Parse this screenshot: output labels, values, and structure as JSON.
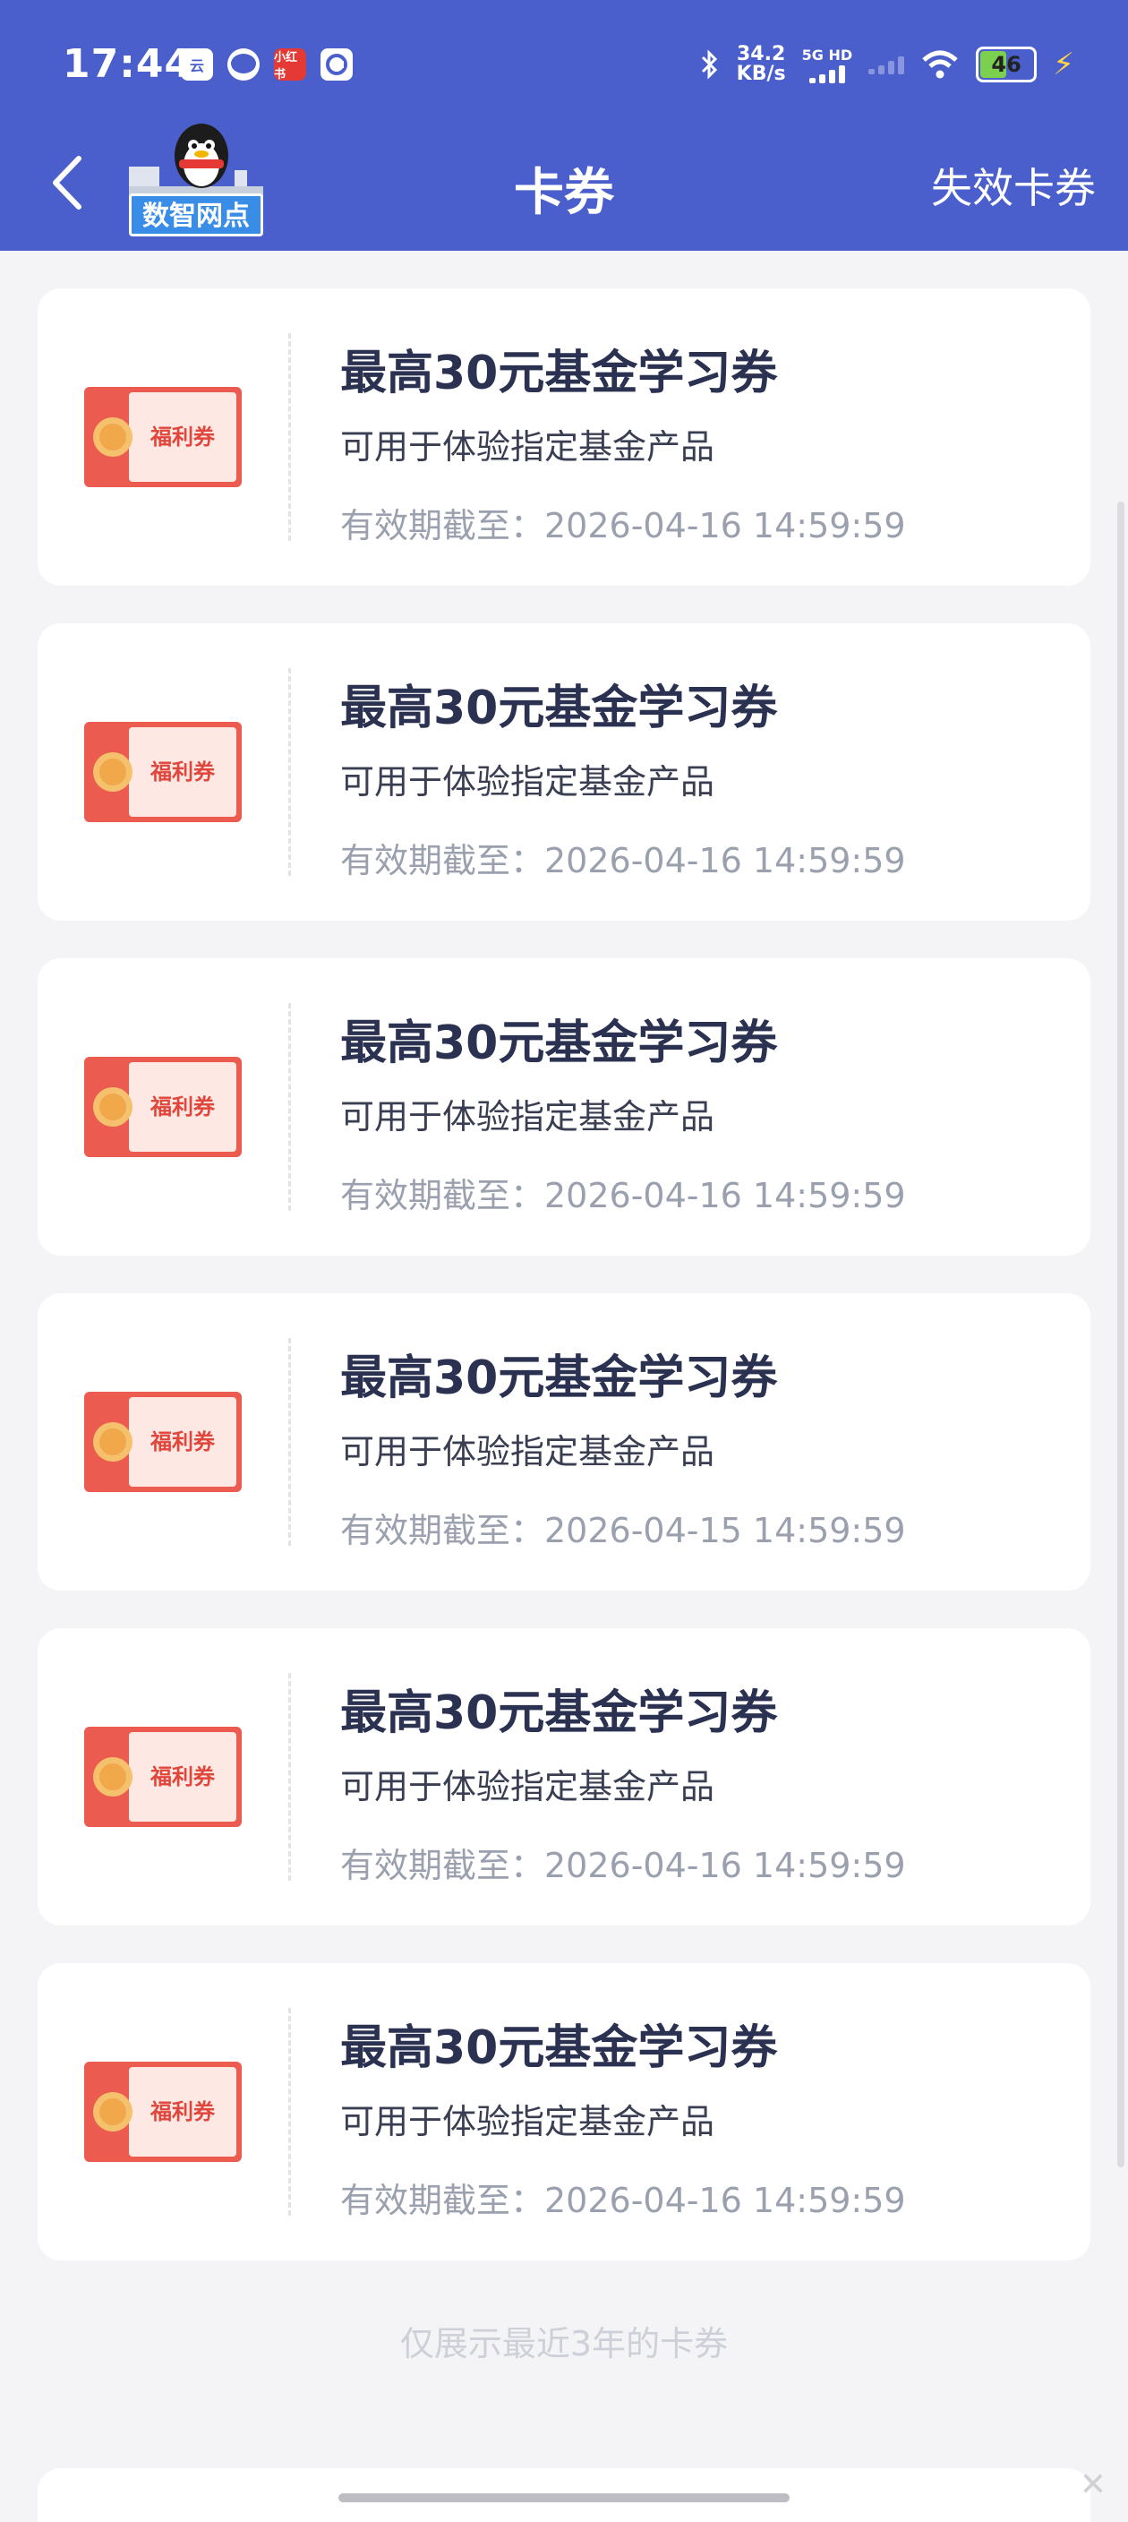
{
  "status_bar": {
    "time": "17:44",
    "net_speed_value": "34.2",
    "net_speed_unit": "KB/s",
    "network_label": "5G HD",
    "battery": "46",
    "app_icon_1": "云",
    "app_icon_3": "小红书"
  },
  "header": {
    "title": "卡券",
    "logo_text": "数智网点",
    "right_link": "失效卡券"
  },
  "coupons": [
    {
      "title": "最高30元基金学习券",
      "desc": "可用于体验指定基金产品",
      "expiry": "有效期截至：2026-04-16 14:59:59",
      "badge": "福利券"
    },
    {
      "title": "最高30元基金学习券",
      "desc": "可用于体验指定基金产品",
      "expiry": "有效期截至：2026-04-16 14:59:59",
      "badge": "福利券"
    },
    {
      "title": "最高30元基金学习券",
      "desc": "可用于体验指定基金产品",
      "expiry": "有效期截至：2026-04-16 14:59:59",
      "badge": "福利券"
    },
    {
      "title": "最高30元基金学习券",
      "desc": "可用于体验指定基金产品",
      "expiry": "有效期截至：2026-04-15 14:59:59",
      "badge": "福利券"
    },
    {
      "title": "最高30元基金学习券",
      "desc": "可用于体验指定基金产品",
      "expiry": "有效期截至：2026-04-16 14:59:59",
      "badge": "福利券"
    },
    {
      "title": "最高30元基金学习券",
      "desc": "可用于体验指定基金产品",
      "expiry": "有效期截至：2026-04-16 14:59:59",
      "badge": "福利券"
    }
  ],
  "footer_note": "仅展示最近3年的卡券",
  "colors": {
    "header_bg": "#4a5fcb",
    "page_bg": "#f4f4f6",
    "ticket_red": "#ec5b4f",
    "title_text": "#2b3150",
    "muted_text": "#9aa0ae"
  }
}
